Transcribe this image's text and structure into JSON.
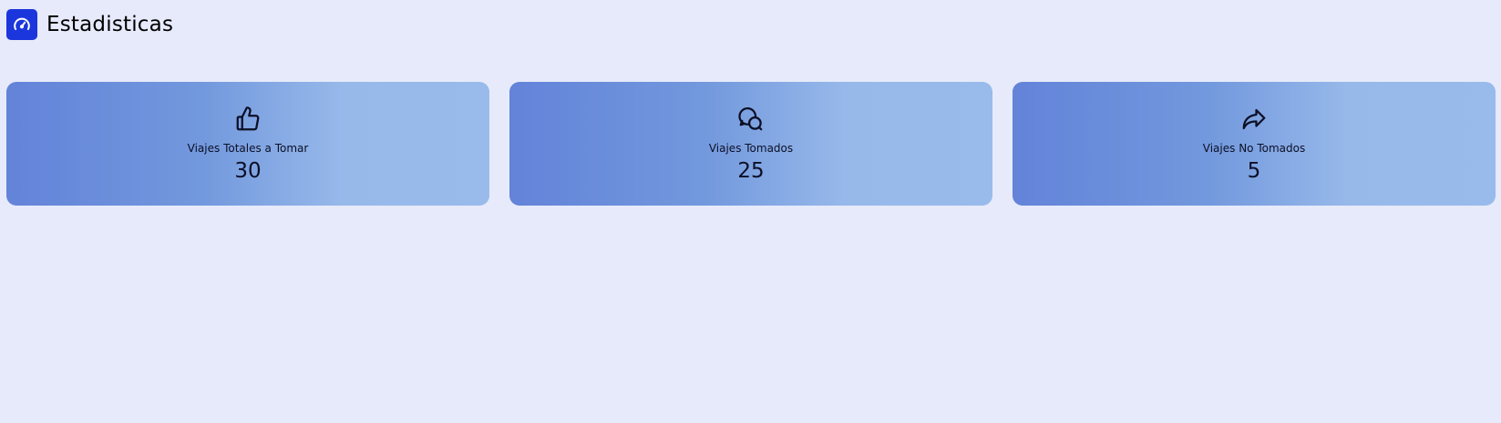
{
  "header": {
    "icon": "speedometer-icon",
    "title": "Estadisticas",
    "icon_bg_color": "#1b36dc"
  },
  "cards": [
    {
      "icon": "thumbs-up-icon",
      "label": "Viajes Totales a Tomar",
      "value": "30"
    },
    {
      "icon": "chat-bubbles-icon",
      "label": "Viajes Tomados",
      "value": "25"
    },
    {
      "icon": "share-arrow-icon",
      "label": "Viajes No Tomados",
      "value": "5"
    }
  ],
  "colors": {
    "background": "#e7eafa",
    "card_gradient_start": "#6383d9",
    "card_gradient_end": "#98bbeb"
  }
}
